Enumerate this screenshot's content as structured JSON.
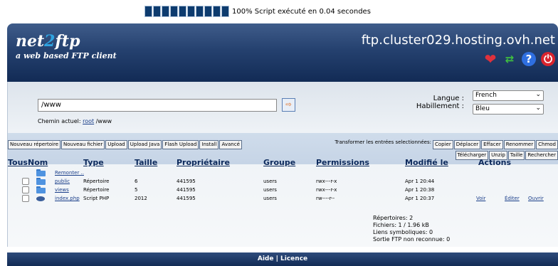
{
  "progress": {
    "percent": 100,
    "segments": 10,
    "text": "100% Script exécuté en 0.04 secondes"
  },
  "header": {
    "logo_a": "net",
    "logo_2": "2",
    "logo_b": "ftp",
    "tagline": "a web based FTP client",
    "host": "ftp.cluster029.hosting.ovh.net",
    "icons": [
      "heart-icon",
      "refresh-icon",
      "help-icon",
      "power-icon"
    ]
  },
  "nav": {
    "directory_value": "/www",
    "chemin_label": "Chemin actuel:",
    "chemin_root": "root",
    "chemin_path": "/www",
    "langue_label": "Langue :",
    "habillement_label": "Habillement :",
    "langue_value": "French",
    "habillement_value": "Bleu"
  },
  "toolbar": {
    "left": [
      "Nouveau répertoire",
      "Nouveau fichier",
      "Upload",
      "Upload Java",
      "Flash Upload",
      "Install",
      "Avancé"
    ],
    "transformer_label": "Transformer les entrées selectionnées:",
    "right_row1": [
      "Copier",
      "Déplacer",
      "Effacer",
      "Renommer",
      "Chmod"
    ],
    "right_row2": [
      "Télécharger",
      "Unzip",
      "Taille",
      "Rechercher"
    ]
  },
  "columns": {
    "tous": "Tous",
    "nom": "Nom",
    "type": "Type",
    "taille": "Taille",
    "proprietaire": "Propriétaire",
    "groupe": "Groupe",
    "permissions": "Permissions",
    "modifie": "Modifié le",
    "actions": "Actions"
  },
  "up_link": "Remonter ..",
  "rows": [
    {
      "name": "public",
      "type": "Répertoire",
      "size": "6",
      "owner": "441595",
      "group": "users",
      "perms": "rwx---r-x",
      "modified": "Apr 1 20:44",
      "actions": []
    },
    {
      "name": "views",
      "type": "Répertoire",
      "size": "5",
      "owner": "441595",
      "group": "users",
      "perms": "rwx---r-x",
      "modified": "Apr 1 20:38",
      "actions": []
    },
    {
      "name": "index.php",
      "type": "Script PHP",
      "size": "2012",
      "owner": "441595",
      "group": "users",
      "perms": "rw----r--",
      "modified": "Apr 1 20:37",
      "actions": [
        "Voir",
        "Éditer",
        "Ouvrir"
      ]
    }
  ],
  "stats": {
    "repertoires": "Répertoires: 2",
    "fichiers": "Fichiers: 1 / 1.96 kB",
    "liens": "Liens symboliques: 0",
    "sortie": "Sortie FTP non reconnue: 0"
  },
  "footer": {
    "aide": "Aide",
    "sep": " | ",
    "licence": "Licence"
  }
}
